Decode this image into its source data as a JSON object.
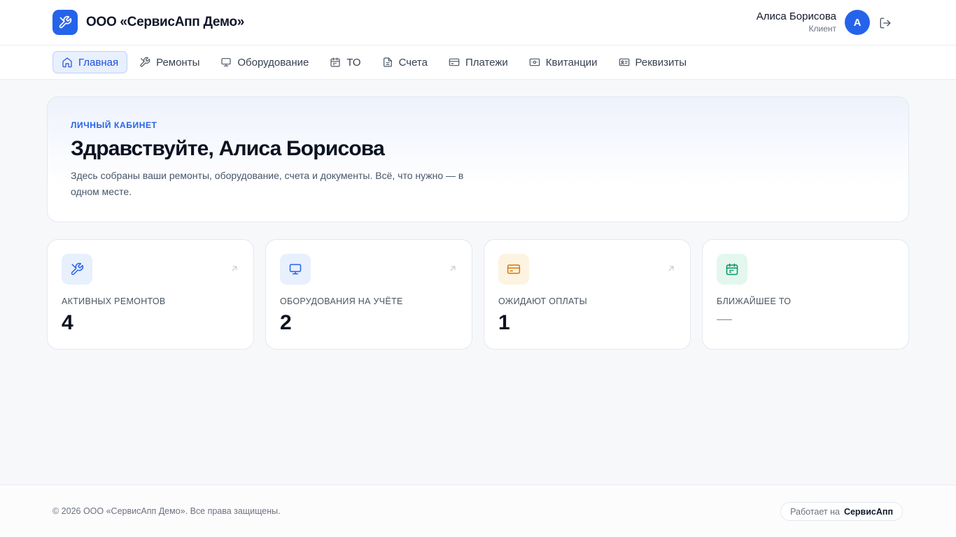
{
  "header": {
    "brand_name": "ООО «СервисАпп Демо»",
    "brand_icon": "tools-icon",
    "user_name": "Алиса Борисова",
    "user_role": "Клиент",
    "avatar_letter": "А",
    "logout_icon": "logout-icon"
  },
  "nav": {
    "items": [
      {
        "label": "Главная",
        "icon": "home-icon",
        "active": true
      },
      {
        "label": "Ремонты",
        "icon": "tools-icon",
        "active": false
      },
      {
        "label": "Оборудование",
        "icon": "monitor-icon",
        "active": false
      },
      {
        "label": "ТО",
        "icon": "calendar-icon",
        "active": false
      },
      {
        "label": "Счета",
        "icon": "document-icon",
        "active": false
      },
      {
        "label": "Платежи",
        "icon": "credit-card-icon",
        "active": false
      },
      {
        "label": "Квитанции",
        "icon": "receipt-icon",
        "active": false
      },
      {
        "label": "Реквизиты",
        "icon": "id-card-icon",
        "active": false
      }
    ]
  },
  "hero": {
    "eyebrow": "ЛИЧНЫЙ КАБИНЕТ",
    "title": "Здравствуйте, Алиса Борисова",
    "text": "Здесь собраны ваши ремонты, оборудование, счета и документы. Всё, что нужно — в одном месте."
  },
  "stats": [
    {
      "label": "АКТИВНЫХ РЕМОНТОВ",
      "value": "4",
      "icon": "tools-icon",
      "color": "#2563eb",
      "bg": "#e8effd"
    },
    {
      "label": "ОБОРУДОВАНИЯ НА УЧЁТЕ",
      "value": "2",
      "icon": "monitor-icon",
      "color": "#2563eb",
      "bg": "#e8effd"
    },
    {
      "label": "ОЖИДАЮТ ОПЛАТЫ",
      "value": "1",
      "icon": "credit-card-icon",
      "color": "#d97706",
      "bg": "#fdf3e1"
    },
    {
      "label": "БЛИЖАЙШЕЕ ТО",
      "value": "—",
      "icon": "calendar-icon",
      "color": "#059669",
      "bg": "#e3f7ee"
    }
  ],
  "footer": {
    "copyright": "© 2026 ООО «СервисАпп Демо». Все права защищены.",
    "powered_label": "Работает на",
    "powered_brand": "СервисАпп"
  },
  "colors": {
    "accent": "#2563eb",
    "background": "#f7f8fa"
  }
}
